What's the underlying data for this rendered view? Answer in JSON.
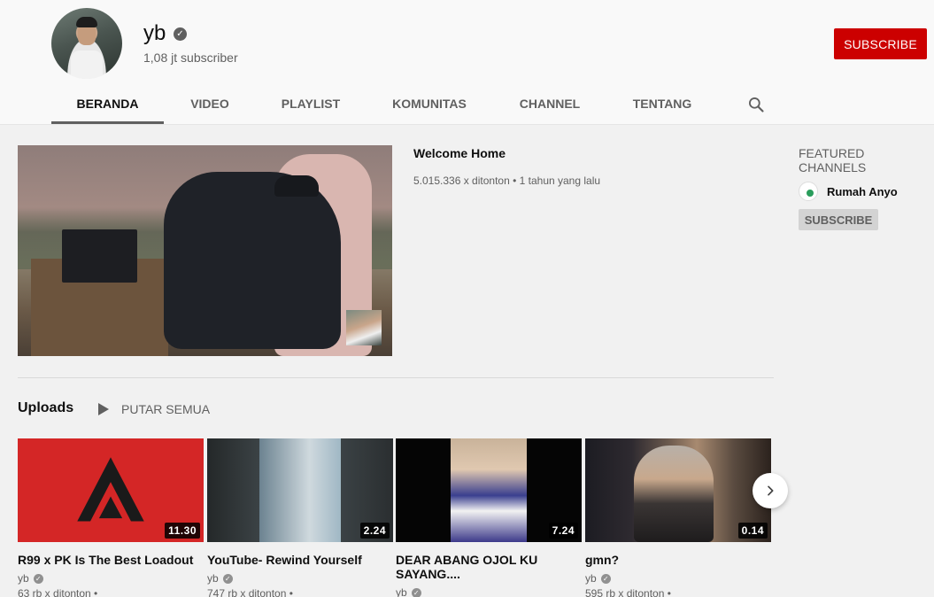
{
  "channel": {
    "name": "yb",
    "subscribers": "1,08 jt subscriber",
    "subscribe_label": "SUBSCRIBE"
  },
  "tabs": [
    "BERANDA",
    "VIDEO",
    "PLAYLIST",
    "KOMUNITAS",
    "CHANNEL",
    "TENTANG"
  ],
  "active_tab": "BERANDA",
  "featured_video": {
    "title": "Welcome Home",
    "meta": "5.015.336 x ditonton • 1 tahun yang lalu"
  },
  "featured_channels": {
    "heading": "FEATURED CHANNELS",
    "items": [
      {
        "name": "Rumah Anyo",
        "subscribe_label": "SUBSCRIBE"
      }
    ]
  },
  "uploads": {
    "title": "Uploads",
    "play_all": "PUTAR SEMUA",
    "videos": [
      {
        "title": "R99 x PK Is The Best Loadout",
        "duration": "11.30",
        "channel": "yb",
        "views": "63 rb x ditonton •"
      },
      {
        "title": "YouTube- Rewind Yourself",
        "duration": "2.24",
        "channel": "yb",
        "views": "747 rb x ditonton •"
      },
      {
        "title": "DEAR ABANG OJOL KU SAYANG....",
        "duration": "7.24",
        "channel": "yb",
        "views": ""
      },
      {
        "title": "gmn?",
        "duration": "0.14",
        "channel": "yb",
        "views": "595 rb x ditonton •"
      }
    ]
  },
  "icons": {
    "verified": "check-badge-icon",
    "search": "search-icon",
    "play": "play-icon",
    "next": "chevron-right-icon"
  },
  "colors": {
    "subscribe": "#cc0000",
    "page_bg": "#f1f1f1",
    "header_bg": "#f9f9f9"
  }
}
